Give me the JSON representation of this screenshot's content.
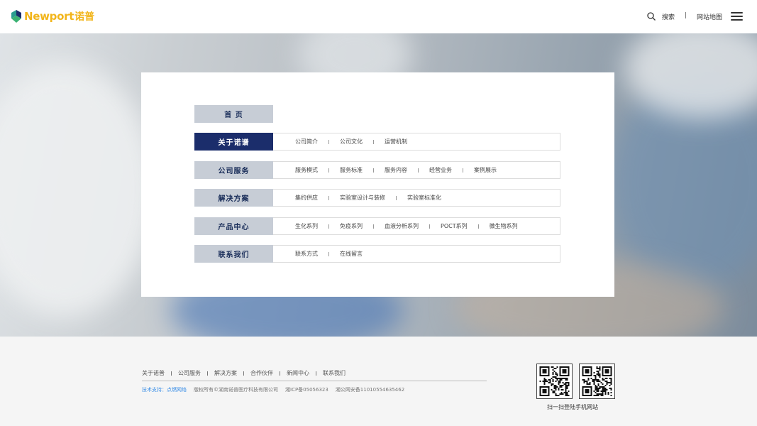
{
  "header": {
    "logo_text": "Newport",
    "logo_cn": "诺普",
    "search_label": "搜索",
    "separator": "|",
    "sitemap_label": "网站地图",
    "brand_color": "#f2b51a"
  },
  "sitemap": {
    "rows": [
      {
        "title": "首 页",
        "active": false,
        "links": []
      },
      {
        "title": "关于诺谱",
        "active": true,
        "links": [
          "公司简介",
          "公司文化",
          "运营机制"
        ]
      },
      {
        "title": "公司服务",
        "active": false,
        "links": [
          "服务模式",
          "服务标准",
          "服务内容",
          "经营业务",
          "案例展示"
        ]
      },
      {
        "title": "解决方案",
        "active": false,
        "links": [
          "集约供应",
          "实验室设计与装修",
          "实验室标准化"
        ]
      },
      {
        "title": "产品中心",
        "active": false,
        "links": [
          "生化系列",
          "免疫系列",
          "血液分析系列",
          "POCT系列",
          "微生物系列"
        ]
      },
      {
        "title": "联系我们",
        "active": false,
        "links": [
          "联系方式",
          "在线留言"
        ]
      }
    ],
    "active_color": "#1b2d6b",
    "title_bg": "#c7cdd6"
  },
  "footer": {
    "nav": [
      "关于诺普",
      "公司服务",
      "解决方案",
      "合作伙伴",
      "新闻中心",
      "联系我们"
    ],
    "tech_support": "技术支持：点燃网络",
    "copyright": "版权所有©湖南诺普医疗科技有限公司",
    "icp": "湘ICP备05056323",
    "police": "湘公网安备11010554635462",
    "qr_caption": "扫一扫登陆手机网站",
    "tech_color": "#3a8ee6"
  }
}
